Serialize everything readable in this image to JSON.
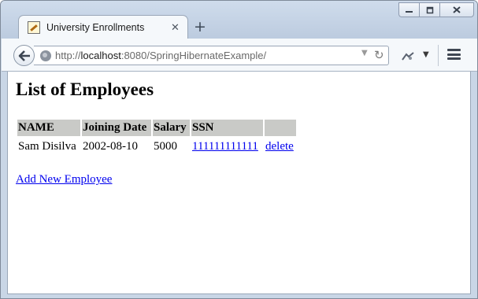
{
  "window": {
    "controls": [
      "minimize",
      "restore",
      "close"
    ]
  },
  "tab": {
    "title": "University Enrollments",
    "close_glyph": "✕",
    "new_tab_glyph": "+"
  },
  "navbar": {
    "url_scheme": "http://",
    "url_host": "localhost",
    "url_rest": ":8080/SpringHibernateExample/",
    "icons": [
      "back-arrow-icon",
      "globe-icon",
      "dropdown-icon",
      "reload-icon",
      "addon-icon",
      "menu-icon"
    ]
  },
  "page": {
    "title": "List of Employees",
    "table": {
      "headers": [
        "NAME",
        "Joining Date",
        "Salary",
        "SSN",
        ""
      ],
      "rows": [
        {
          "name": "Sam Disilva",
          "joining_date": "2002-08-10",
          "salary": "5000",
          "ssn": "111111111111",
          "action": "delete"
        }
      ]
    },
    "add_link": "Add New Employee"
  },
  "colors": {
    "link": "#0000ee",
    "header_bg": "#c9cac7",
    "chrome": "#c9d6e6"
  }
}
